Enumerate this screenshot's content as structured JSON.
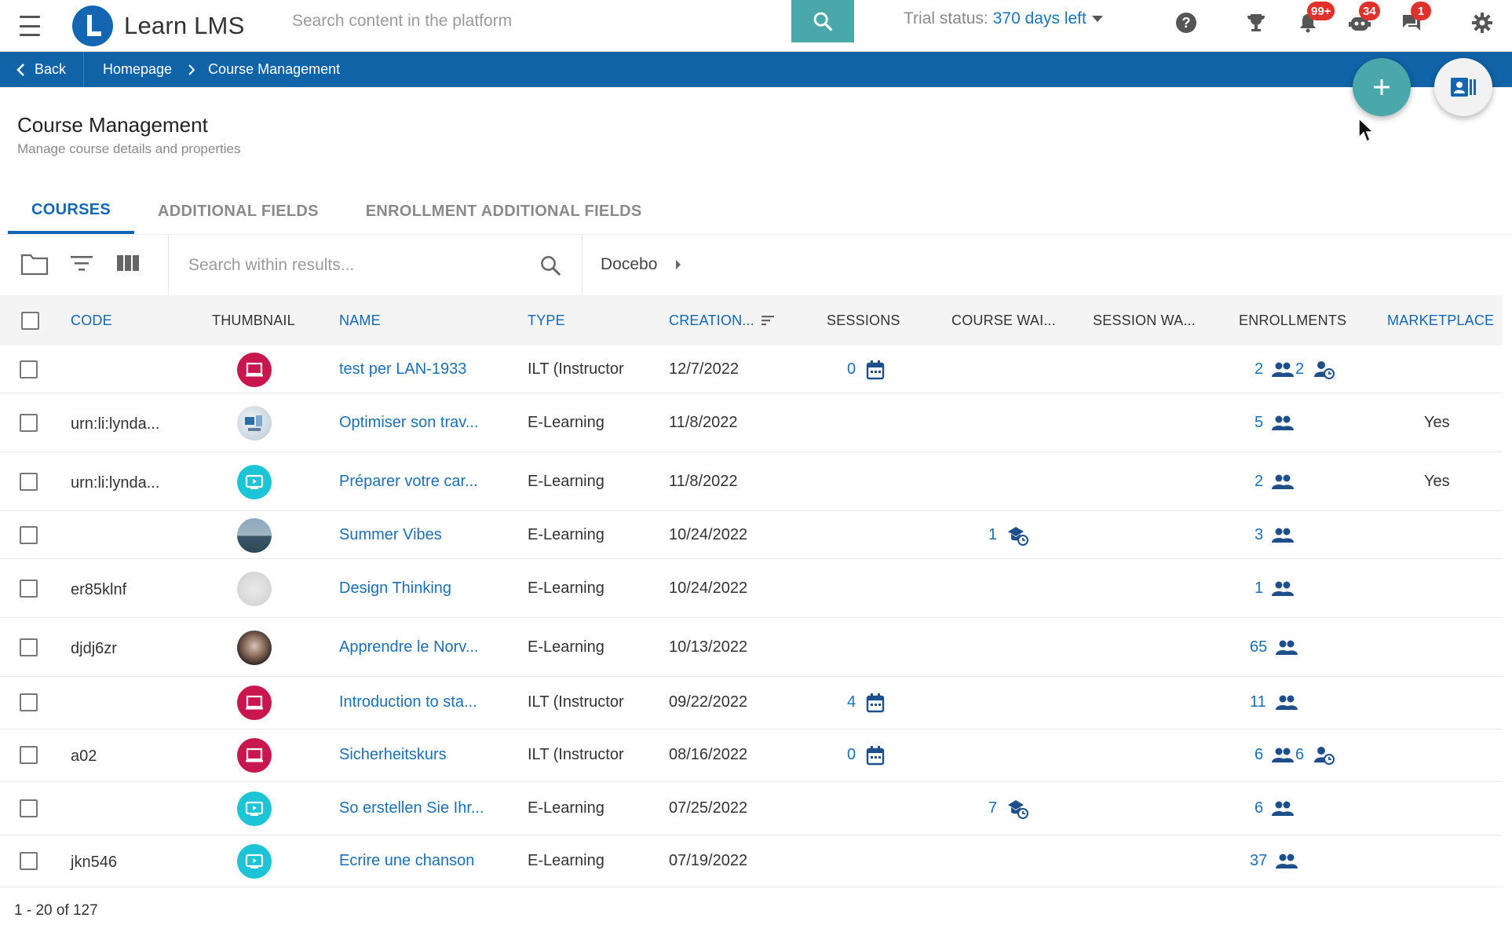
{
  "app": {
    "name": "Learn LMS"
  },
  "header": {
    "search_placeholder": "Search content in the platform",
    "trial_prefix": "Trial status:",
    "trial_days": "370 days left",
    "badges": {
      "notifications": "99+",
      "bot": "34",
      "messages": "1"
    }
  },
  "breadcrumb": {
    "back": "Back",
    "items": [
      "Homepage",
      "Course Management"
    ]
  },
  "page": {
    "title": "Course Management",
    "subtitle": "Manage course details and properties"
  },
  "tabs": [
    "COURSES",
    "ADDITIONAL FIELDS",
    "ENROLLMENT ADDITIONAL FIELDS"
  ],
  "toolbar": {
    "search_placeholder": "Search within results...",
    "branch": "Docebo"
  },
  "columns": {
    "code": "CODE",
    "thumbnail": "THUMBNAIL",
    "name": "NAME",
    "type": "TYPE",
    "creation": "CREATION...",
    "sessions": "SESSIONS",
    "course_wait": "COURSE WAI...",
    "session_wait": "SESSION WA...",
    "enrollments": "ENROLLMENTS",
    "marketplace": "MARKETPLACE"
  },
  "rows": [
    {
      "code": "",
      "thumb": "ilt",
      "name": "test per LAN-1933",
      "type": "ILT (Instructor",
      "date": "12/7/2022",
      "sessions": "0",
      "course_wait": "",
      "enroll": "2",
      "enroll_extra": "2",
      "marketplace": ""
    },
    {
      "code": "urn:li:lynda...",
      "thumb": "photo1",
      "name": "Optimiser son trav...",
      "type": "E-Learning",
      "date": "11/8/2022",
      "sessions": "",
      "course_wait": "",
      "enroll": "5",
      "enroll_extra": "",
      "marketplace": "Yes"
    },
    {
      "code": "urn:li:lynda...",
      "thumb": "video",
      "name": "Préparer votre car...",
      "type": "E-Learning",
      "date": "11/8/2022",
      "sessions": "",
      "course_wait": "",
      "enroll": "2",
      "enroll_extra": "",
      "marketplace": "Yes"
    },
    {
      "code": "",
      "thumb": "photo2",
      "name": "Summer Vibes",
      "type": "E-Learning",
      "date": "10/24/2022",
      "sessions": "",
      "course_wait": "1",
      "enroll": "3",
      "enroll_extra": "",
      "marketplace": ""
    },
    {
      "code": "er85klnf",
      "thumb": "photo3",
      "name": "Design Thinking",
      "type": "E-Learning",
      "date": "10/24/2022",
      "sessions": "",
      "course_wait": "",
      "enroll": "1",
      "enroll_extra": "",
      "marketplace": ""
    },
    {
      "code": "djdj6zr",
      "thumb": "photo4",
      "name": "Apprendre le Norv...",
      "type": "E-Learning",
      "date": "10/13/2022",
      "sessions": "",
      "course_wait": "",
      "enroll": "65",
      "enroll_extra": "",
      "marketplace": ""
    },
    {
      "code": "",
      "thumb": "ilt",
      "name": "Introduction to sta...",
      "type": "ILT (Instructor",
      "date": "09/22/2022",
      "sessions": "4",
      "course_wait": "",
      "enroll": "11",
      "enroll_extra": "",
      "marketplace": ""
    },
    {
      "code": "a02",
      "thumb": "ilt",
      "name": "Sicherheitskurs",
      "type": "ILT (Instructor",
      "date": "08/16/2022",
      "sessions": "0",
      "course_wait": "",
      "enroll": "6",
      "enroll_extra": "6",
      "marketplace": ""
    },
    {
      "code": "",
      "thumb": "video",
      "name": "So erstellen Sie Ihr...",
      "type": "E-Learning",
      "date": "07/25/2022",
      "sessions": "",
      "course_wait": "7",
      "enroll": "6",
      "enroll_extra": "",
      "marketplace": ""
    },
    {
      "code": "jkn546",
      "thumb": "video",
      "name": "Ecrire une chanson",
      "type": "E-Learning",
      "date": "07/19/2022",
      "sessions": "",
      "course_wait": "",
      "enroll": "37",
      "enroll_extra": "",
      "marketplace": ""
    }
  ],
  "pager": {
    "text": "1 - 20 of 127"
  },
  "colors": {
    "brand": "#0f63a6",
    "accent": "#4aa7aa",
    "link": "#1f6fb0",
    "badge": "#e0312d",
    "ilt": "#c8174f",
    "video": "#1cc4d6"
  }
}
